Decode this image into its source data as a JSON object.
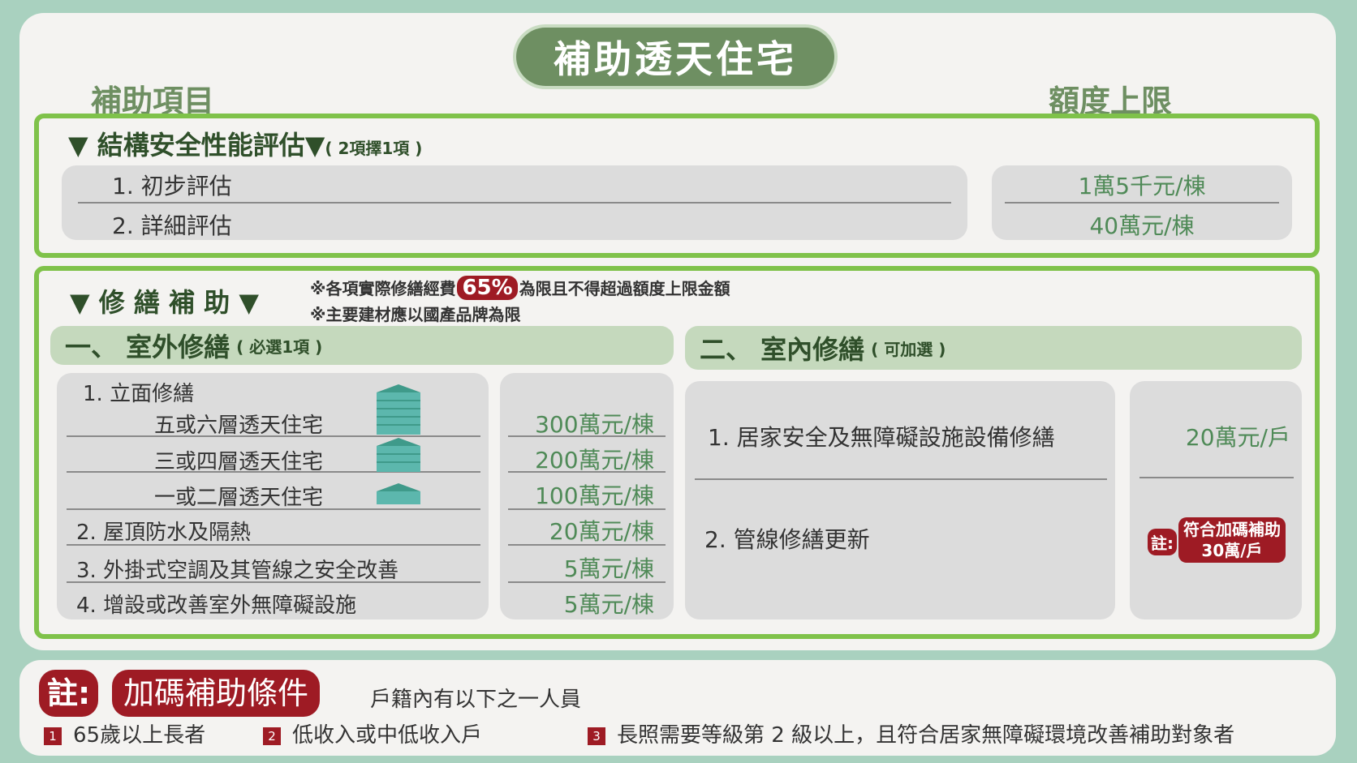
{
  "title": "補助透天住宅",
  "col_items": "補助項目",
  "col_limit": "額度上限",
  "structural": {
    "heading": "▼ 結構安全性能評估▼",
    "note": "( 2項擇1項 )",
    "items": [
      "1. 初步評估",
      "2. 詳細評估"
    ],
    "amounts": [
      "1萬5千元/棟",
      "40萬元/棟"
    ]
  },
  "repair": {
    "heading": "▼ 修 繕 補 助 ▼",
    "note1_a": "※各項實際修繕經費",
    "note1_pct": "65%",
    "note1_b": "為限且不得超過額度上限金額",
    "note2": "※主要建材應以國產品牌為限"
  },
  "outdoor": {
    "heading": "一、 室外修繕",
    "note": "( 必選1項 )",
    "item1": "1. 立面修繕",
    "sub": [
      "五或六層透天住宅",
      "三或四層透天住宅",
      "一或二層透天住宅"
    ],
    "item2": "2. 屋頂防水及隔熱",
    "item3": "3. 外掛式空調及其管線之安全改善",
    "item4": "4. 增設或改善室外無障礙設施",
    "amounts": [
      "300萬元/棟",
      "200萬元/棟",
      "100萬元/棟",
      "20萬元/棟",
      "5萬元/棟",
      "5萬元/棟"
    ]
  },
  "indoor": {
    "heading": "二、 室內修繕",
    "note": "( 可加選 )",
    "item1": "1. 居家安全及無障礙設施設備修繕",
    "item2": "2. 管線修繕更新",
    "amount1": "20萬元/戶",
    "bonus_label": "註:",
    "bonus_line1": "符合加碼補助",
    "bonus_line2": "30萬/戶"
  },
  "footer": {
    "note_label": "註:",
    "bonus_title": "加碼補助條件",
    "intro": "戶籍內有以下之一人員",
    "conditions": [
      {
        "num": "1",
        "text": "65歲以上長者"
      },
      {
        "num": "2",
        "text": "低收入或中低收入戶"
      },
      {
        "num": "3",
        "text": "長照需要等級第 2 級以上，且符合居家無障礙環境改善補助對象者"
      }
    ]
  },
  "colors": {
    "bg": "#a9d1bf",
    "accent_green": "#7fc24a",
    "dark_green": "#6e8f62",
    "amount_green": "#4f8a57",
    "red": "#9e1b24"
  }
}
